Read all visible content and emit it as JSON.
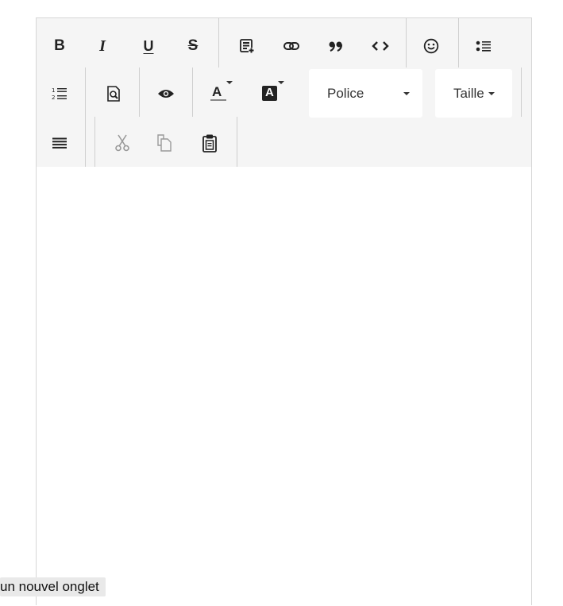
{
  "toolbar": {
    "bold_label": "B",
    "italic_label": "I",
    "underline_label": "U",
    "strike_label": "S",
    "font_color_label": "A",
    "bg_color_label": "A",
    "font_select_value": "Police",
    "size_select_value": "Taille"
  },
  "tooltip": {
    "text": "un nouvel onglet"
  },
  "colors": {
    "toolbar_bg": "#f5f5f5",
    "border": "#d6d6d6",
    "icon": "#222222",
    "disabled_icon": "#9a9a9a"
  },
  "icons": {
    "row1": [
      "bold-icon",
      "italic-icon",
      "underline-icon",
      "strikethrough-icon",
      "insert-template-icon",
      "link-icon",
      "blockquote-icon",
      "code-icon",
      "emoji-icon",
      "bullet-list-icon"
    ],
    "row2": [
      "numbered-list-icon",
      "find-icon",
      "preview-icon",
      "font-color-icon",
      "background-color-icon"
    ],
    "row3": [
      "justify-icon",
      "cut-icon",
      "copy-icon",
      "paste-icon"
    ]
  }
}
